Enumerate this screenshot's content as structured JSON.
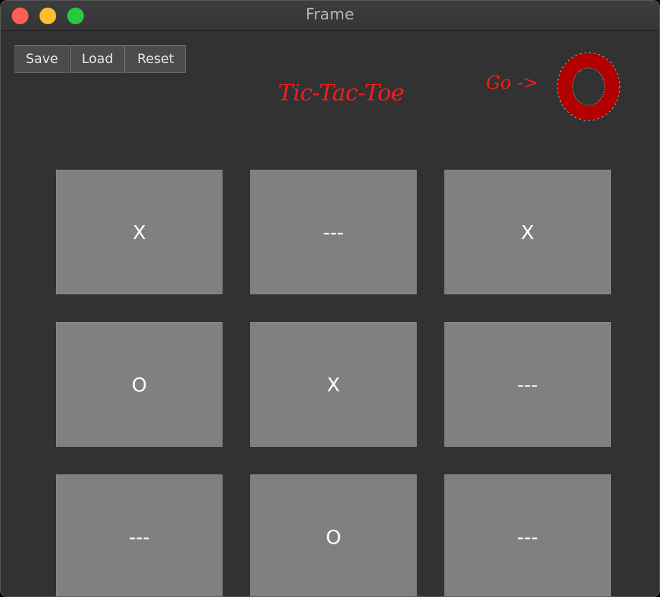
{
  "window": {
    "title": "Frame",
    "controls": {
      "close_color": "#ff5f57",
      "minimize_color": "#febc2e",
      "zoom_color": "#28c840"
    }
  },
  "toolbar": {
    "save_label": "Save",
    "load_label": "Load",
    "reset_label": "Reset"
  },
  "header": {
    "title": "Tic-Tac-Toe",
    "turn_label": "Go ->",
    "current_player_icon": "o-mark-icon",
    "accent_color": "#ff1a1a",
    "mark_color": "#b30000"
  },
  "board": {
    "cells": [
      [
        "X",
        "---",
        "X"
      ],
      [
        "O",
        "X",
        "---"
      ],
      [
        "---",
        "O",
        "---"
      ]
    ]
  }
}
